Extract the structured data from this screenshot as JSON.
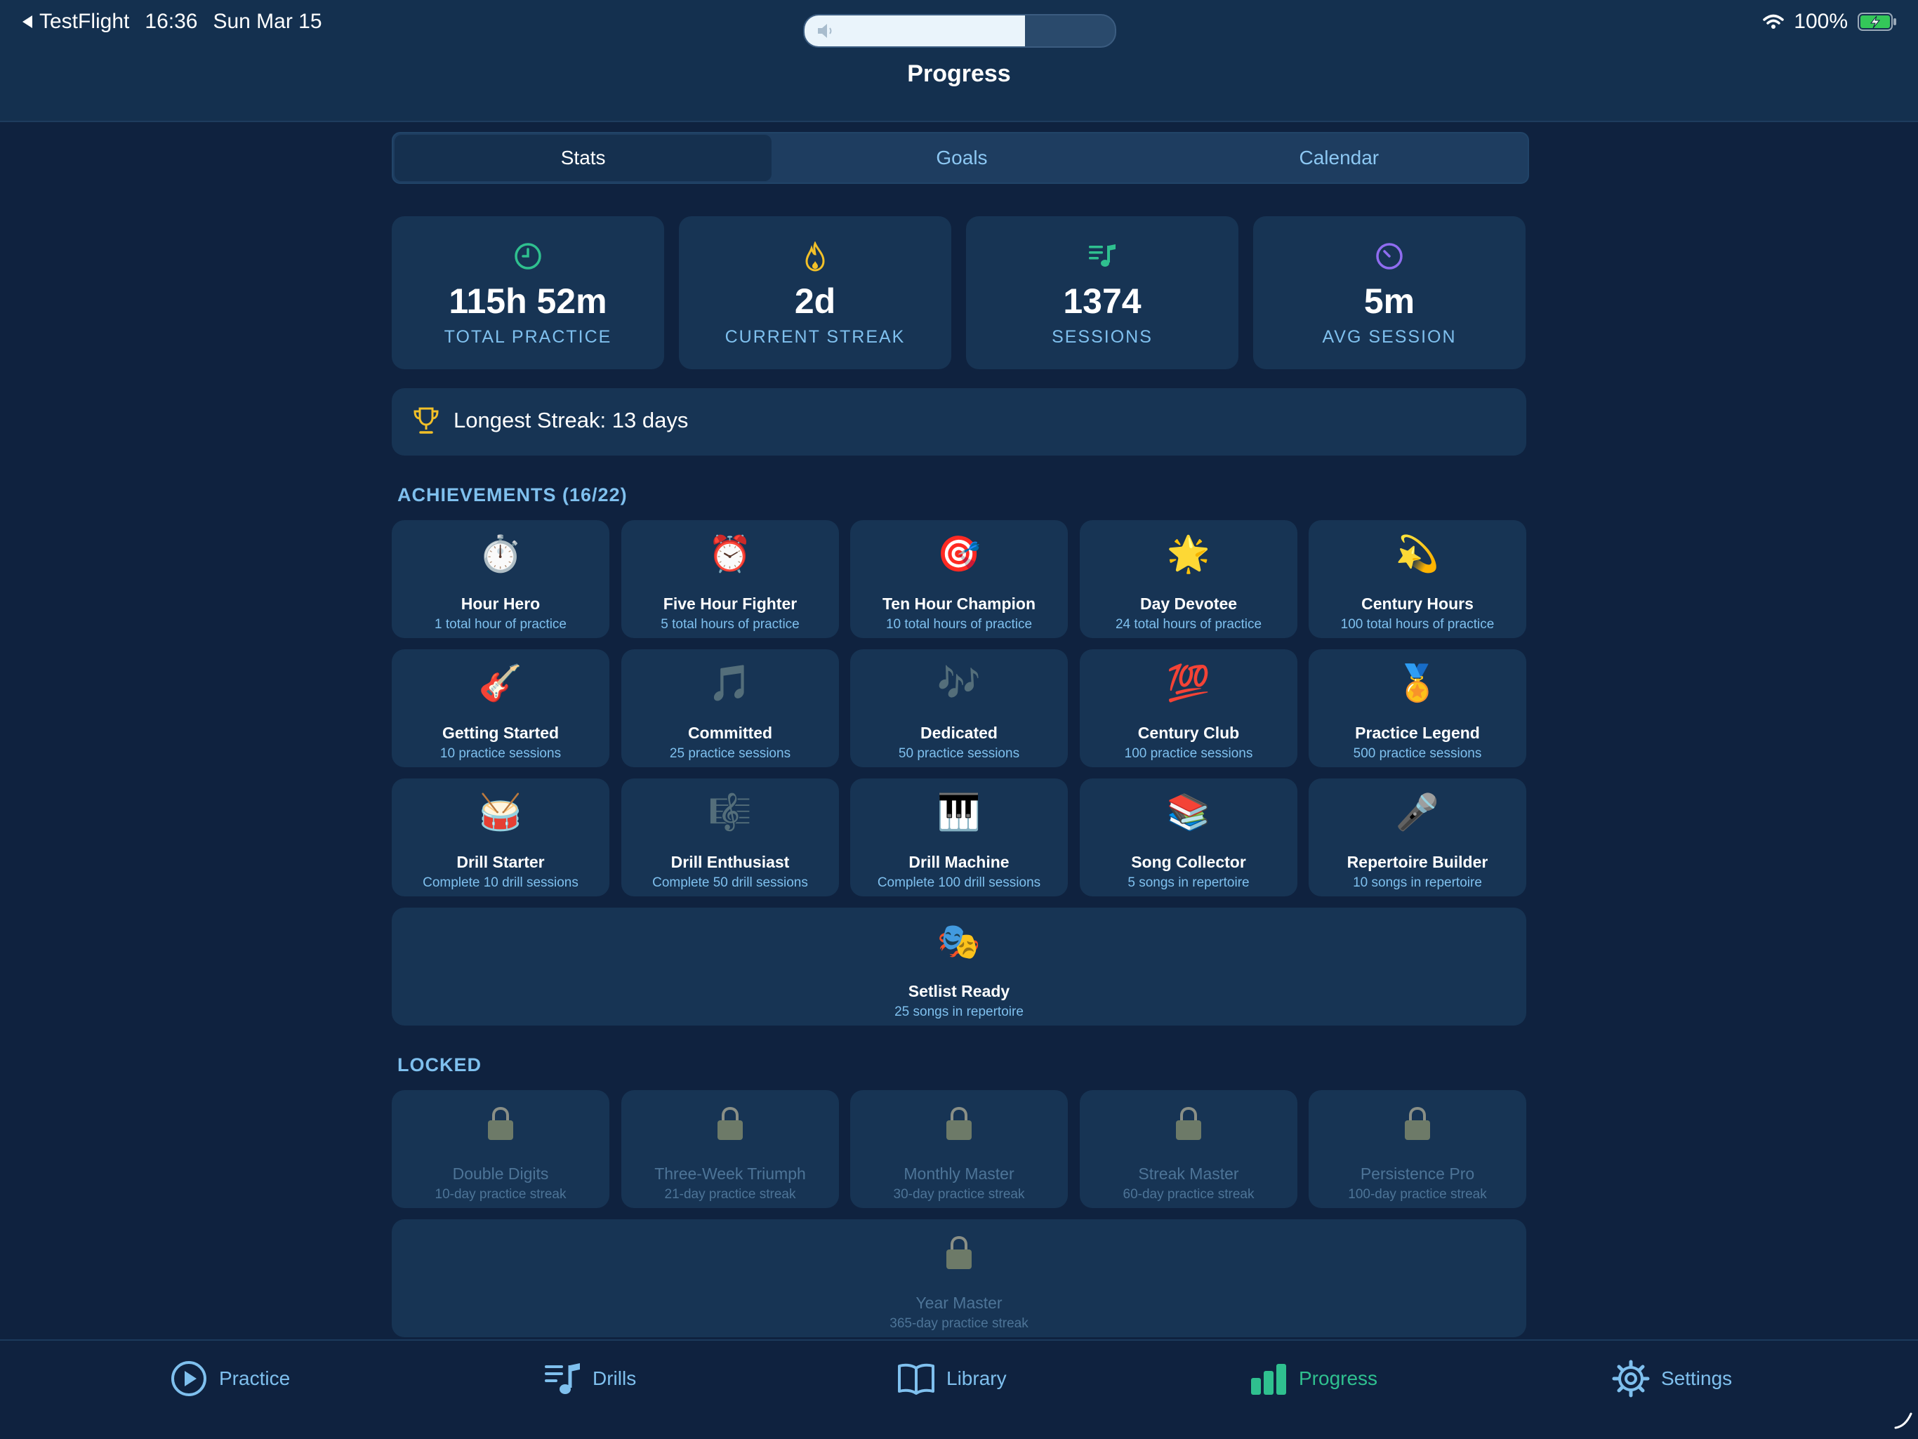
{
  "status_bar": {
    "back_app": "TestFlight",
    "time": "16:36",
    "date": "Sun Mar 15",
    "battery": "100%",
    "volume_level": 0.71
  },
  "header": {
    "title": "Progress"
  },
  "tabs": [
    {
      "label": "Stats",
      "active": true
    },
    {
      "label": "Goals",
      "active": false
    },
    {
      "label": "Calendar",
      "active": false
    }
  ],
  "stats": [
    {
      "icon": "clock-icon",
      "value": "115h 52m",
      "label": "TOTAL PRACTICE",
      "color": "#2fc08f"
    },
    {
      "icon": "flame-icon",
      "value": "2d",
      "label": "CURRENT STREAK",
      "color": "#f2c028"
    },
    {
      "icon": "music-list-icon",
      "value": "1374",
      "label": "SESSIONS",
      "color": "#2fc08f"
    },
    {
      "icon": "gauge-icon",
      "value": "5m",
      "label": "AVG SESSION",
      "color": "#8f6cf0"
    }
  ],
  "longest_streak": "Longest Streak: 13 days",
  "achievements": {
    "title": "ACHIEVEMENTS (16/22)",
    "items": [
      {
        "emoji": "⏱️",
        "name": "Hour Hero",
        "desc": "1 total hour of practice"
      },
      {
        "emoji": "⏰",
        "name": "Five Hour Fighter",
        "desc": "5 total hours of practice"
      },
      {
        "emoji": "🎯",
        "name": "Ten Hour Champion",
        "desc": "10 total hours of practice"
      },
      {
        "emoji": "🌟",
        "name": "Day Devotee",
        "desc": "24 total hours of practice"
      },
      {
        "emoji": "💫",
        "name": "Century Hours",
        "desc": "100 total hours of practice"
      },
      {
        "emoji": "🎸",
        "name": "Getting Started",
        "desc": "10 practice sessions"
      },
      {
        "emoji": "🎵",
        "name": "Committed",
        "desc": "25 practice sessions"
      },
      {
        "emoji": "🎶",
        "name": "Dedicated",
        "desc": "50 practice sessions"
      },
      {
        "emoji": "💯",
        "name": "Century Club",
        "desc": "100 practice sessions"
      },
      {
        "emoji": "🏅",
        "name": "Practice Legend",
        "desc": "500 practice sessions"
      },
      {
        "emoji": "🥁",
        "name": "Drill Starter",
        "desc": "Complete 10 drill sessions"
      },
      {
        "emoji": "🎼",
        "name": "Drill Enthusiast",
        "desc": "Complete 50 drill sessions"
      },
      {
        "emoji": "🎹",
        "name": "Drill Machine",
        "desc": "Complete 100 drill sessions"
      },
      {
        "emoji": "📚",
        "name": "Song Collector",
        "desc": "5 songs in repertoire"
      },
      {
        "emoji": "🎤",
        "name": "Repertoire Builder",
        "desc": "10 songs in repertoire"
      },
      {
        "emoji": "🎭",
        "name": "Setlist Ready",
        "desc": "25 songs in repertoire"
      }
    ]
  },
  "locked": {
    "title": "LOCKED",
    "items": [
      {
        "name": "Double Digits",
        "desc": "10-day practice streak"
      },
      {
        "name": "Three-Week Triumph",
        "desc": "21-day practice streak"
      },
      {
        "name": "Monthly Master",
        "desc": "30-day practice streak"
      },
      {
        "name": "Streak Master",
        "desc": "60-day practice streak"
      },
      {
        "name": "Persistence Pro",
        "desc": "100-day practice streak"
      },
      {
        "name": "Year Master",
        "desc": "365-day practice streak"
      }
    ]
  },
  "tab_bar": [
    {
      "icon": "play-circle-icon",
      "label": "Practice",
      "active": false
    },
    {
      "icon": "music-list-icon",
      "label": "Drills",
      "active": false
    },
    {
      "icon": "book-icon",
      "label": "Library",
      "active": false
    },
    {
      "icon": "bar-chart-icon",
      "label": "Progress",
      "active": true
    },
    {
      "icon": "gear-icon",
      "label": "Settings",
      "active": false
    }
  ],
  "colors": {
    "accent_green": "#2fc08f",
    "accent_blue": "#7fc0ee",
    "background": "#0f223f",
    "card": "#173454"
  }
}
